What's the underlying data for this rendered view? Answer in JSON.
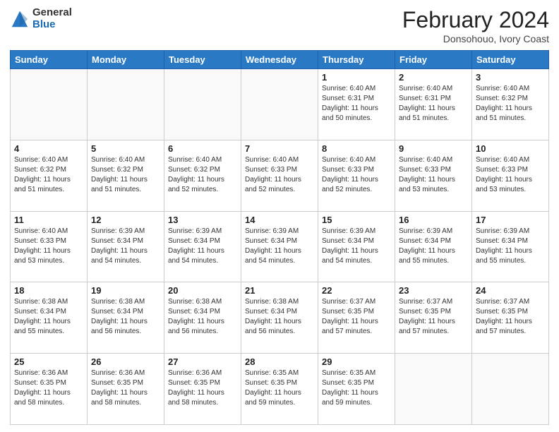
{
  "header": {
    "logo_general": "General",
    "logo_blue": "Blue",
    "month_title": "February 2024",
    "subtitle": "Donsohouo, Ivory Coast"
  },
  "days_of_week": [
    "Sunday",
    "Monday",
    "Tuesday",
    "Wednesday",
    "Thursday",
    "Friday",
    "Saturday"
  ],
  "weeks": [
    [
      {
        "day": "",
        "info": ""
      },
      {
        "day": "",
        "info": ""
      },
      {
        "day": "",
        "info": ""
      },
      {
        "day": "",
        "info": ""
      },
      {
        "day": "1",
        "info": "Sunrise: 6:40 AM\nSunset: 6:31 PM\nDaylight: 11 hours and 50 minutes."
      },
      {
        "day": "2",
        "info": "Sunrise: 6:40 AM\nSunset: 6:31 PM\nDaylight: 11 hours and 51 minutes."
      },
      {
        "day": "3",
        "info": "Sunrise: 6:40 AM\nSunset: 6:32 PM\nDaylight: 11 hours and 51 minutes."
      }
    ],
    [
      {
        "day": "4",
        "info": "Sunrise: 6:40 AM\nSunset: 6:32 PM\nDaylight: 11 hours and 51 minutes."
      },
      {
        "day": "5",
        "info": "Sunrise: 6:40 AM\nSunset: 6:32 PM\nDaylight: 11 hours and 51 minutes."
      },
      {
        "day": "6",
        "info": "Sunrise: 6:40 AM\nSunset: 6:32 PM\nDaylight: 11 hours and 52 minutes."
      },
      {
        "day": "7",
        "info": "Sunrise: 6:40 AM\nSunset: 6:33 PM\nDaylight: 11 hours and 52 minutes."
      },
      {
        "day": "8",
        "info": "Sunrise: 6:40 AM\nSunset: 6:33 PM\nDaylight: 11 hours and 52 minutes."
      },
      {
        "day": "9",
        "info": "Sunrise: 6:40 AM\nSunset: 6:33 PM\nDaylight: 11 hours and 53 minutes."
      },
      {
        "day": "10",
        "info": "Sunrise: 6:40 AM\nSunset: 6:33 PM\nDaylight: 11 hours and 53 minutes."
      }
    ],
    [
      {
        "day": "11",
        "info": "Sunrise: 6:40 AM\nSunset: 6:33 PM\nDaylight: 11 hours and 53 minutes."
      },
      {
        "day": "12",
        "info": "Sunrise: 6:39 AM\nSunset: 6:34 PM\nDaylight: 11 hours and 54 minutes."
      },
      {
        "day": "13",
        "info": "Sunrise: 6:39 AM\nSunset: 6:34 PM\nDaylight: 11 hours and 54 minutes."
      },
      {
        "day": "14",
        "info": "Sunrise: 6:39 AM\nSunset: 6:34 PM\nDaylight: 11 hours and 54 minutes."
      },
      {
        "day": "15",
        "info": "Sunrise: 6:39 AM\nSunset: 6:34 PM\nDaylight: 11 hours and 54 minutes."
      },
      {
        "day": "16",
        "info": "Sunrise: 6:39 AM\nSunset: 6:34 PM\nDaylight: 11 hours and 55 minutes."
      },
      {
        "day": "17",
        "info": "Sunrise: 6:39 AM\nSunset: 6:34 PM\nDaylight: 11 hours and 55 minutes."
      }
    ],
    [
      {
        "day": "18",
        "info": "Sunrise: 6:38 AM\nSunset: 6:34 PM\nDaylight: 11 hours and 55 minutes."
      },
      {
        "day": "19",
        "info": "Sunrise: 6:38 AM\nSunset: 6:34 PM\nDaylight: 11 hours and 56 minutes."
      },
      {
        "day": "20",
        "info": "Sunrise: 6:38 AM\nSunset: 6:34 PM\nDaylight: 11 hours and 56 minutes."
      },
      {
        "day": "21",
        "info": "Sunrise: 6:38 AM\nSunset: 6:34 PM\nDaylight: 11 hours and 56 minutes."
      },
      {
        "day": "22",
        "info": "Sunrise: 6:37 AM\nSunset: 6:35 PM\nDaylight: 11 hours and 57 minutes."
      },
      {
        "day": "23",
        "info": "Sunrise: 6:37 AM\nSunset: 6:35 PM\nDaylight: 11 hours and 57 minutes."
      },
      {
        "day": "24",
        "info": "Sunrise: 6:37 AM\nSunset: 6:35 PM\nDaylight: 11 hours and 57 minutes."
      }
    ],
    [
      {
        "day": "25",
        "info": "Sunrise: 6:36 AM\nSunset: 6:35 PM\nDaylight: 11 hours and 58 minutes."
      },
      {
        "day": "26",
        "info": "Sunrise: 6:36 AM\nSunset: 6:35 PM\nDaylight: 11 hours and 58 minutes."
      },
      {
        "day": "27",
        "info": "Sunrise: 6:36 AM\nSunset: 6:35 PM\nDaylight: 11 hours and 58 minutes."
      },
      {
        "day": "28",
        "info": "Sunrise: 6:35 AM\nSunset: 6:35 PM\nDaylight: 11 hours and 59 minutes."
      },
      {
        "day": "29",
        "info": "Sunrise: 6:35 AM\nSunset: 6:35 PM\nDaylight: 11 hours and 59 minutes."
      },
      {
        "day": "",
        "info": ""
      },
      {
        "day": "",
        "info": ""
      }
    ]
  ]
}
